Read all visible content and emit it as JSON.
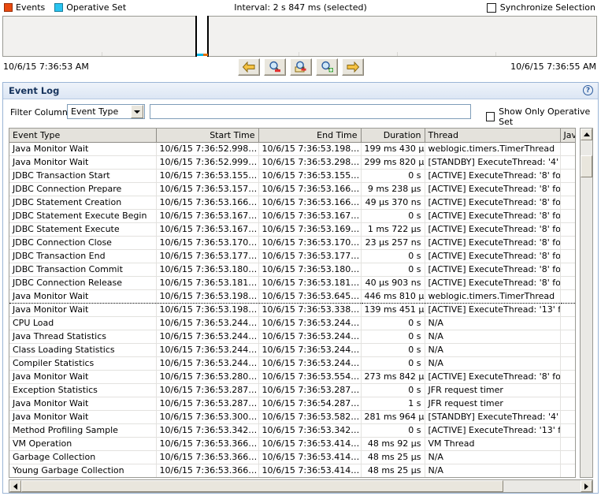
{
  "timeline": {
    "legend": [
      {
        "label": "Events",
        "color": "#e8490f",
        "icon": "square-swatch-icon"
      },
      {
        "label": "Operative Set",
        "color": "#29c4f0",
        "icon": "square-swatch-icon"
      }
    ],
    "interval_label": "Interval: 2 s 847 ms (selected)",
    "sync_selection_label": "Synchronize Selection",
    "sync_selection_checked": false,
    "range_start_time": "10/6/15 7:36:53 AM",
    "range_end_time": "10/6/15 7:36:55 AM",
    "nav_buttons": [
      {
        "name": "pan-left-button",
        "icon": "arrow-left-icon",
        "label": "Pan Left"
      },
      {
        "name": "zoom-out-button",
        "icon": "magnifier-minus-icon",
        "label": "Zoom Out"
      },
      {
        "name": "reset-zoom-button",
        "icon": "magnifier-minus-page-icon",
        "label": "Reset Zoom"
      },
      {
        "name": "zoom-in-button",
        "icon": "magnifier-plus-icon",
        "label": "Zoom In"
      },
      {
        "name": "pan-right-button",
        "icon": "arrow-right-icon",
        "label": "Pan Right"
      }
    ]
  },
  "panel": {
    "title": "Event Log",
    "help_icon": "?",
    "filter_label": "Filter Column",
    "filter_column_value": "Event Type",
    "filter_text_value": "",
    "filter_text_placeholder": "",
    "show_only_operative_set_label": "Show Only Operative Set",
    "show_only_operative_set_checked": false
  },
  "table": {
    "columns": [
      {
        "label": "Event Type",
        "align": "left"
      },
      {
        "label": "Start Time",
        "align": "right"
      },
      {
        "label": "End Time",
        "align": "right"
      },
      {
        "label": "Duration",
        "align": "right"
      },
      {
        "label": "Thread",
        "align": "left"
      },
      {
        "label": "Java",
        "align": "left",
        "sort": "ascending"
      }
    ],
    "rows": [
      {
        "event_type": "Java Monitor Wait",
        "start_time": "10/6/15 7:36:52.998…",
        "end_time": "10/6/15 7:36:53.198…",
        "duration": "199 ms 430 µs",
        "thread": "weblogic.timers.TimerThread",
        "java": "",
        "focused": false
      },
      {
        "event_type": "Java Monitor Wait",
        "start_time": "10/6/15 7:36:52.999…",
        "end_time": "10/6/15 7:36:53.298…",
        "duration": "299 ms 820 µs",
        "thread": "[STANDBY] ExecuteThread: '4' …",
        "java": "",
        "focused": false
      },
      {
        "event_type": "JDBC Transaction Start",
        "start_time": "10/6/15 7:36:53.155…",
        "end_time": "10/6/15 7:36:53.155…",
        "duration": "0 s",
        "thread": "[ACTIVE] ExecuteThread: '8' fo…",
        "java": "",
        "focused": false
      },
      {
        "event_type": "JDBC Connection Prepare",
        "start_time": "10/6/15 7:36:53.157…",
        "end_time": "10/6/15 7:36:53.166…",
        "duration": "9 ms 238 µs",
        "thread": "[ACTIVE] ExecuteThread: '8' fo…",
        "java": "",
        "focused": false
      },
      {
        "event_type": "JDBC Statement Creation",
        "start_time": "10/6/15 7:36:53.166…",
        "end_time": "10/6/15 7:36:53.166…",
        "duration": "49 µs 370 ns",
        "thread": "[ACTIVE] ExecuteThread: '8' fo…",
        "java": "",
        "focused": false
      },
      {
        "event_type": "JDBC Statement Execute Begin",
        "start_time": "10/6/15 7:36:53.167…",
        "end_time": "10/6/15 7:36:53.167…",
        "duration": "0 s",
        "thread": "[ACTIVE] ExecuteThread: '8' fo…",
        "java": "",
        "focused": false
      },
      {
        "event_type": "JDBC Statement Execute",
        "start_time": "10/6/15 7:36:53.167…",
        "end_time": "10/6/15 7:36:53.169…",
        "duration": "1 ms 722 µs",
        "thread": "[ACTIVE] ExecuteThread: '8' fo…",
        "java": "",
        "focused": false
      },
      {
        "event_type": "JDBC Connection Close",
        "start_time": "10/6/15 7:36:53.170…",
        "end_time": "10/6/15 7:36:53.170…",
        "duration": "23 µs 257 ns",
        "thread": "[ACTIVE] ExecuteThread: '8' fo…",
        "java": "",
        "focused": false
      },
      {
        "event_type": "JDBC Transaction End",
        "start_time": "10/6/15 7:36:53.177…",
        "end_time": "10/6/15 7:36:53.177…",
        "duration": "0 s",
        "thread": "[ACTIVE] ExecuteThread: '8' fo…",
        "java": "",
        "focused": false
      },
      {
        "event_type": "JDBC Transaction Commit",
        "start_time": "10/6/15 7:36:53.180…",
        "end_time": "10/6/15 7:36:53.180…",
        "duration": "0 s",
        "thread": "[ACTIVE] ExecuteThread: '8' fo…",
        "java": "",
        "focused": false
      },
      {
        "event_type": "JDBC Connection Release",
        "start_time": "10/6/15 7:36:53.181…",
        "end_time": "10/6/15 7:36:53.181…",
        "duration": "40 µs 903 ns",
        "thread": "[ACTIVE] ExecuteThread: '8' fo…",
        "java": "",
        "focused": false
      },
      {
        "event_type": "Java Monitor Wait",
        "start_time": "10/6/15 7:36:53.198…",
        "end_time": "10/6/15 7:36:53.645…",
        "duration": "446 ms 810 µs",
        "thread": "weblogic.timers.TimerThread",
        "java": "",
        "focused": true
      },
      {
        "event_type": "Java Monitor Wait",
        "start_time": "10/6/15 7:36:53.198…",
        "end_time": "10/6/15 7:36:53.338…",
        "duration": "139 ms 451 µs",
        "thread": "[ACTIVE] ExecuteThread: '13' f…",
        "java": "",
        "focused": false
      },
      {
        "event_type": "CPU Load",
        "start_time": "10/6/15 7:36:53.244…",
        "end_time": "10/6/15 7:36:53.244…",
        "duration": "0 s",
        "thread": "N/A",
        "java": "",
        "focused": false
      },
      {
        "event_type": "Java Thread Statistics",
        "start_time": "10/6/15 7:36:53.244…",
        "end_time": "10/6/15 7:36:53.244…",
        "duration": "0 s",
        "thread": "N/A",
        "java": "",
        "focused": false
      },
      {
        "event_type": "Class Loading Statistics",
        "start_time": "10/6/15 7:36:53.244…",
        "end_time": "10/6/15 7:36:53.244…",
        "duration": "0 s",
        "thread": "N/A",
        "java": "",
        "focused": false
      },
      {
        "event_type": "Compiler Statistics",
        "start_time": "10/6/15 7:36:53.244…",
        "end_time": "10/6/15 7:36:53.244…",
        "duration": "0 s",
        "thread": "N/A",
        "java": "",
        "focused": false
      },
      {
        "event_type": "Java Monitor Wait",
        "start_time": "10/6/15 7:36:53.280…",
        "end_time": "10/6/15 7:36:53.554…",
        "duration": "273 ms 842 µs",
        "thread": "[ACTIVE] ExecuteThread: '8' fo…",
        "java": "",
        "focused": false
      },
      {
        "event_type": "Exception Statistics",
        "start_time": "10/6/15 7:36:53.287…",
        "end_time": "10/6/15 7:36:53.287…",
        "duration": "0 s",
        "thread": "JFR request timer",
        "java": "",
        "focused": false
      },
      {
        "event_type": "Java Monitor Wait",
        "start_time": "10/6/15 7:36:53.287…",
        "end_time": "10/6/15 7:36:54.287…",
        "duration": "1 s",
        "thread": "JFR request timer",
        "java": "",
        "focused": false
      },
      {
        "event_type": "Java Monitor Wait",
        "start_time": "10/6/15 7:36:53.300…",
        "end_time": "10/6/15 7:36:53.582…",
        "duration": "281 ms 964 µs",
        "thread": "[STANDBY] ExecuteThread: '4' …",
        "java": "",
        "focused": false
      },
      {
        "event_type": "Method Profiling Sample",
        "start_time": "10/6/15 7:36:53.342…",
        "end_time": "10/6/15 7:36:53.342…",
        "duration": "0 s",
        "thread": "[ACTIVE] ExecuteThread: '13' f…",
        "java": "",
        "focused": false
      },
      {
        "event_type": "VM Operation",
        "start_time": "10/6/15 7:36:53.366…",
        "end_time": "10/6/15 7:36:53.414…",
        "duration": "48 ms 92 µs",
        "thread": "VM Thread",
        "java": "",
        "focused": false
      },
      {
        "event_type": "Garbage Collection",
        "start_time": "10/6/15 7:36:53.366…",
        "end_time": "10/6/15 7:36:53.414…",
        "duration": "48 ms 25 µs",
        "thread": "N/A",
        "java": "",
        "focused": false
      },
      {
        "event_type": "Young Garbage Collection",
        "start_time": "10/6/15 7:36:53.366…",
        "end_time": "10/6/15 7:36:53.414…",
        "duration": "48 ms 25 µs",
        "thread": "N/A",
        "java": "",
        "focused": false
      }
    ]
  }
}
